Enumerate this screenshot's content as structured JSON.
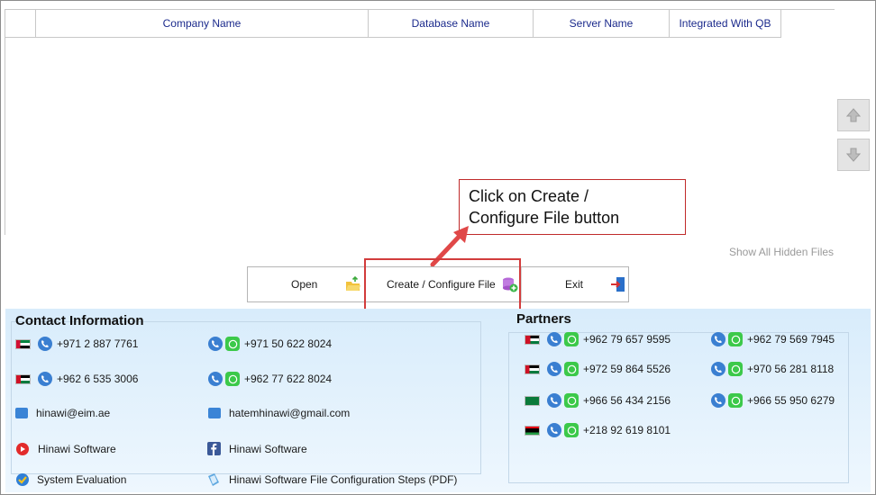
{
  "grid": {
    "columns": [
      "",
      "Company Name",
      "Database Name",
      "Server Name",
      "Integrated With QB"
    ]
  },
  "side_buttons": {
    "up_icon": "arrow-up-icon",
    "down_icon": "arrow-down-icon"
  },
  "show_hidden_files": "Show All Hidden Files",
  "callout": {
    "line1": "Click on Create /",
    "line2": "Configure File button"
  },
  "buttons": {
    "open": "Open",
    "create": "Create / Configure File",
    "exit": "Exit"
  },
  "contact": {
    "title": "Contact Information",
    "phone1": "+971 2 887 7761",
    "mobile1": "+971 50 622 8024",
    "phone2": "+962 6 535 3006",
    "mobile2": "+962 77 622 8024",
    "email1": "hinawi@eim.ae",
    "email2": "hatemhinawi@gmail.com",
    "youtube": "Hinawi Software",
    "facebook": "Hinawi Software",
    "evaluation": "System Evaluation",
    "pdf": "Hinawi Software File Configuration Steps (PDF)"
  },
  "partners": {
    "title": "Partners",
    "p1": "+962 79 657 9595",
    "p2": "+962 79 569 7945",
    "p3": "+972 59 864 5526",
    "p4": "+970 56 281 8118",
    "p5": "+966 56 434 2156",
    "p6": "+966 55 950 6279",
    "p7": "+218 92 619 8101"
  },
  "colors": {
    "accent": "#1b2a8c",
    "highlight": "#d23c3c",
    "phone": "#3a7fd1",
    "whatsapp": "#3cc94a"
  }
}
